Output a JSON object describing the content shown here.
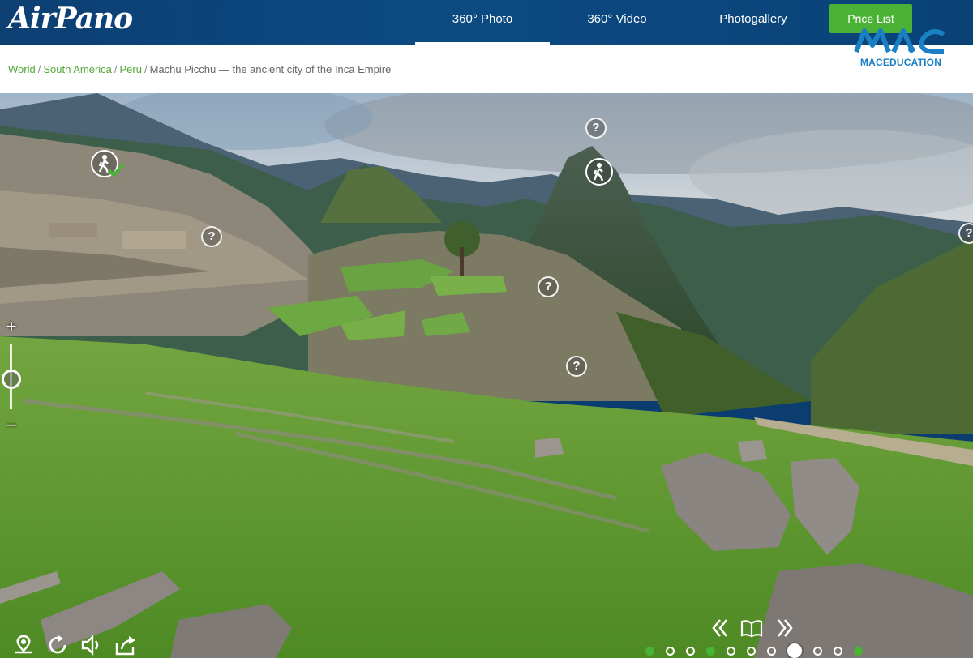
{
  "header": {
    "logo": "AirPano",
    "nav": [
      {
        "label": "360° Photo",
        "active": true
      },
      {
        "label": "360° Video",
        "active": false
      },
      {
        "label": "Photogallery",
        "active": false
      }
    ],
    "price_button": "Price List"
  },
  "watermark": {
    "brand": "MACEDUCATION"
  },
  "breadcrumb": {
    "items": [
      "World",
      "South America",
      "Peru"
    ],
    "current": "Machu Picchu — the ancient city of the Inca Empire"
  },
  "viewer": {
    "zoom_plus": "+",
    "zoom_minus": "−",
    "hotspot_symbol": "?",
    "slide_count": 11,
    "current_slide": 8,
    "visited_slides": [
      1,
      4,
      11
    ]
  },
  "icons": [
    "map-pin-icon",
    "rotate-icon",
    "sound-icon",
    "share-icon",
    "prev-icon",
    "book-icon",
    "next-icon",
    "hiking-icon",
    "check-icon",
    "help-icon"
  ]
}
